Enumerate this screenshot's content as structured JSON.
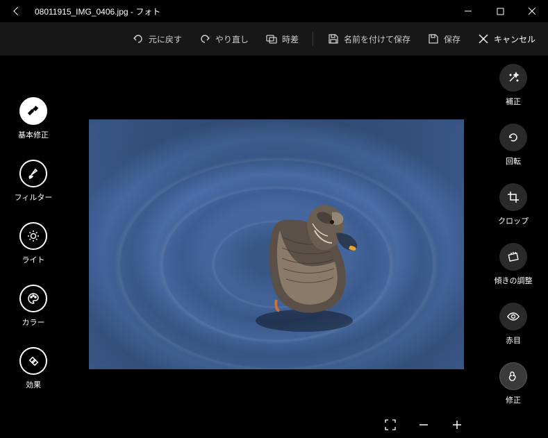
{
  "window": {
    "title": "08011915_IMG_0406.jpg - フォト"
  },
  "toolbar": {
    "undo": "元に戻す",
    "redo": "やり直し",
    "compare": "時差",
    "save_as": "名前を付けて保存",
    "save": "保存",
    "cancel": "キャンセル"
  },
  "left_tools": {
    "basic": "基本修正",
    "filter": "フィルター",
    "light": "ライト",
    "color": "カラー",
    "effect": "効果"
  },
  "right_tools": {
    "enhance": "補正",
    "rotate": "回転",
    "crop": "クロップ",
    "straighten": "傾きの調整",
    "redeye": "赤目",
    "retouch": "修正"
  }
}
